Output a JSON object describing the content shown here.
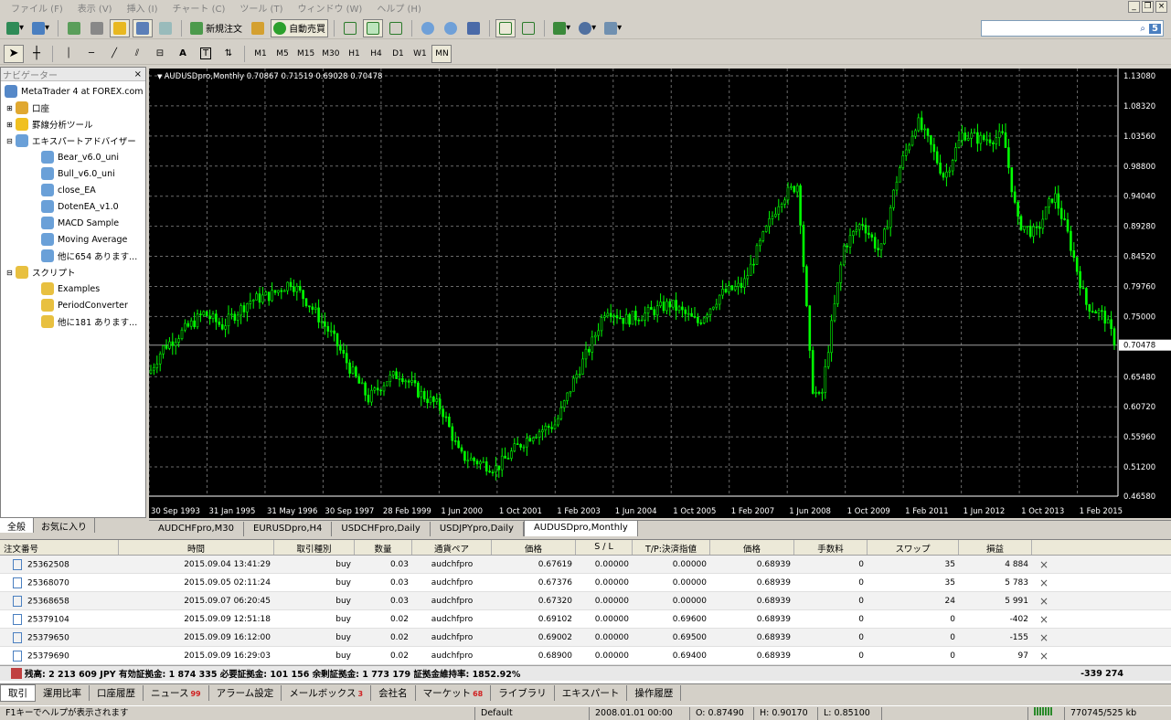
{
  "menu": [
    "ファイル (F)",
    "表示 (V)",
    "挿入 (I)",
    "チャート (C)",
    "ツール (T)",
    "ウィンドウ (W)",
    "ヘルプ (H)"
  ],
  "toolbar": {
    "new_order": "新規注文",
    "auto_trade": "自動売買"
  },
  "timeframes": [
    "M1",
    "M5",
    "M15",
    "M30",
    "H1",
    "H4",
    "D1",
    "W1",
    "MN"
  ],
  "navigator": {
    "title": "ナビゲーター",
    "root": "MetaTrader 4 at FOREX.com",
    "accounts": "口座",
    "indicators": "罫線分析ツール",
    "experts": "エキスパートアドバイザー",
    "expert_items": [
      "Bear_v6.0_uni",
      "Bull_v6.0_uni",
      "close_EA",
      "DotenEA_v1.0",
      "MACD Sample",
      "Moving Average",
      "他に654 あります..."
    ],
    "scripts": "スクリプト",
    "script_items": [
      "Examples",
      "PeriodConverter",
      "他に181 あります..."
    ],
    "tabs": [
      "全般",
      "お気に入り"
    ]
  },
  "chart": {
    "title": "AUDUSDpro,Monthly  0.70867 0.71519 0.69028 0.70478",
    "price_labels": [
      "1.13080",
      "1.08320",
      "1.03560",
      "0.98800",
      "0.94040",
      "0.89280",
      "0.84520",
      "0.79760",
      "0.75000",
      "0.70478",
      "0.65480",
      "0.60720",
      "0.55960",
      "0.51200",
      "0.46580"
    ],
    "time_labels": [
      "30 Sep 1993",
      "31 Jan 1995",
      "31 May 1996",
      "30 Sep 1997",
      "28 Feb 1999",
      "1 Jun 2000",
      "1 Oct 2001",
      "1 Feb 2003",
      "1 Jun 2004",
      "1 Oct 2005",
      "1 Feb 2007",
      "1 Jun 2008",
      "1 Oct 2009",
      "1 Feb 2011",
      "1 Jun 2012",
      "1 Oct 2013",
      "1 Feb 2015"
    ],
    "current_price": "0.70478",
    "bull_color": "#00ff00",
    "bear_color": "#00ff00"
  },
  "chart_tabs": [
    "AUDCHFpro,M30",
    "EURUSDpro,H4",
    "USDCHFpro,Daily",
    "USDJPYpro,Daily",
    "AUDUSDpro,Monthly"
  ],
  "orders": {
    "headers": [
      "注文番号",
      "時間",
      "取引種別",
      "数量",
      "通貨ペア",
      "価格",
      "S / L",
      "T/P:決済指値",
      "価格",
      "手数料",
      "スワップ",
      "損益"
    ],
    "rows": [
      [
        "25362508",
        "2015.09.04 13:41:29",
        "buy",
        "0.03",
        "audchfpro",
        "0.67619",
        "0.00000",
        "0.00000",
        "0.68939",
        "0",
        "35",
        "4 884"
      ],
      [
        "25368070",
        "2015.09.05 02:11:24",
        "buy",
        "0.03",
        "audchfpro",
        "0.67376",
        "0.00000",
        "0.00000",
        "0.68939",
        "0",
        "35",
        "5 783"
      ],
      [
        "25368658",
        "2015.09.07 06:20:45",
        "buy",
        "0.03",
        "audchfpro",
        "0.67320",
        "0.00000",
        "0.00000",
        "0.68939",
        "0",
        "24",
        "5 991"
      ],
      [
        "25379104",
        "2015.09.09 12:51:18",
        "buy",
        "0.02",
        "audchfpro",
        "0.69102",
        "0.00000",
        "0.69600",
        "0.68939",
        "0",
        "0",
        "-402"
      ],
      [
        "25379650",
        "2015.09.09 16:12:00",
        "buy",
        "0.02",
        "audchfpro",
        "0.69002",
        "0.00000",
        "0.69500",
        "0.68939",
        "0",
        "0",
        "-155"
      ],
      [
        "25379690",
        "2015.09.09 16:29:03",
        "buy",
        "0.02",
        "audchfpro",
        "0.68900",
        "0.00000",
        "0.69400",
        "0.68939",
        "0",
        "0",
        "97"
      ]
    ],
    "balance_line": "残高: 2 213 609 JPY  有効証拠金: 1 874 335  必要証拠金: 101 156  余剰証拠金: 1 773 179  証拠金維持率: 1852.92%",
    "total": "-339 274"
  },
  "bottom_tabs": [
    {
      "label": "取引",
      "badge": ""
    },
    {
      "label": "運用比率",
      "badge": ""
    },
    {
      "label": "口座履歴",
      "badge": ""
    },
    {
      "label": "ニュース",
      "badge": "99"
    },
    {
      "label": "アラーム設定",
      "badge": ""
    },
    {
      "label": "メールボックス",
      "badge": "3"
    },
    {
      "label": "会社名",
      "badge": ""
    },
    {
      "label": "マーケット",
      "badge": "68"
    },
    {
      "label": "ライブラリ",
      "badge": ""
    },
    {
      "label": "エキスパート",
      "badge": ""
    },
    {
      "label": "操作履歴",
      "badge": ""
    }
  ],
  "status": {
    "help": "F1キーでヘルプが表示されます",
    "profile": "Default",
    "datetime": "2008.01.01 00:00",
    "open": "O: 0.87490",
    "high": "H: 0.90170",
    "low": "L: 0.85100",
    "traffic": "770745/525 kb"
  }
}
